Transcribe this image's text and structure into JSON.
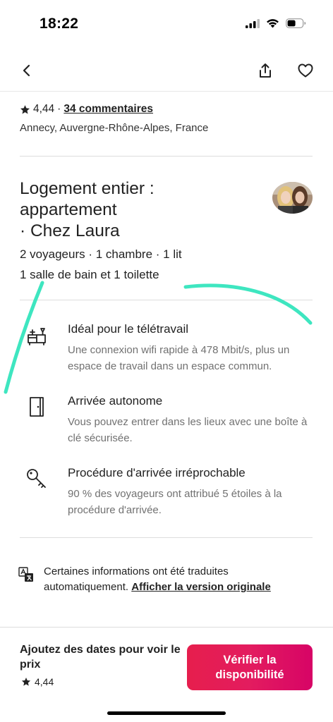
{
  "status": {
    "time": "18:22"
  },
  "listing": {
    "rating": "4,44",
    "separator": "·",
    "reviews": "34 commentaires",
    "location": "Annecy, Auvergne-Rhône-Alpes, France"
  },
  "host": {
    "title_line1": "Logement entier :",
    "title_line2": "appartement",
    "title_line3": "· Chez Laura",
    "details_line1": "2 voyageurs · 1 chambre · 1 lit",
    "details_line2": "1 salle de bain et 1 toilette"
  },
  "features": [
    {
      "title": "Idéal pour le télétravail",
      "description": "Une connexion wifi rapide à 478 Mbit/s, plus un espace de travail dans un espace commun.",
      "icon": "desk-icon"
    },
    {
      "title": "Arrivée autonome",
      "description": "Vous pouvez entrer dans les lieux avec une boîte à clé sécurisée.",
      "icon": "door-icon"
    },
    {
      "title": "Procédure d'arrivée irréprochable",
      "description": "90 % des voyageurs ont attribué 5 étoiles à la procédure d'arrivée.",
      "icon": "key-icon"
    }
  ],
  "translation": {
    "text": "Certaines informations ont été traduites automatiquement.",
    "link": "Afficher la version originale"
  },
  "footer": {
    "price_text": "Ajoutez des dates pour voir le prix",
    "rating": "4,44",
    "cta_label": "Vérifier la disponibilité"
  },
  "colors": {
    "accent": "#e31c5f",
    "annotation": "#3ee6c0",
    "text": "#222222",
    "muted": "#717171"
  }
}
